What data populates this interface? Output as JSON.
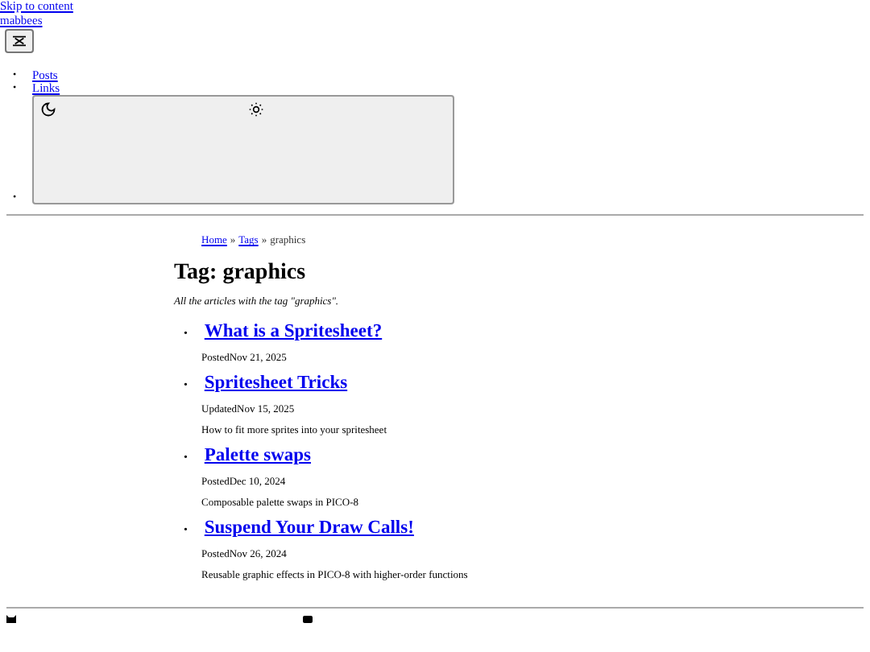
{
  "skip_link": "Skip to content",
  "site_title": "mabbees",
  "nav": {
    "items": [
      {
        "marker": "•",
        "label": "Posts"
      },
      {
        "marker": "•",
        "label": "Links"
      }
    ],
    "theme_marker": "•"
  },
  "breadcrumb": [
    {
      "label": "Home",
      "kind": "link"
    },
    {
      "label": "»",
      "kind": "sep"
    },
    {
      "label": "Tags",
      "kind": "link"
    },
    {
      "label": "»",
      "kind": "sep"
    },
    {
      "label": "graphics",
      "kind": "current"
    }
  ],
  "heading": "Tag: graphics",
  "description": "All the articles with the tag \"graphics\".",
  "posts": [
    {
      "marker": "•",
      "title": "What is a Spritesheet?",
      "date_label": "Posted",
      "date": "Nov 21, 2025"
    },
    {
      "marker": "•",
      "title": "Spritesheet Tricks",
      "date_label": "Updated",
      "date": "Nov 15, 2025",
      "summary": "How to fit more sprites into your spritesheet"
    },
    {
      "marker": "•",
      "title": "Palette swaps",
      "date_label": "Posted",
      "date": "Dec 10, 2024",
      "summary": "Composable palette swaps in PICO-8"
    },
    {
      "marker": "•",
      "title": "Suspend Your Draw Calls!",
      "date_label": "Posted",
      "date": "Nov 26, 2024",
      "summary": "Reusable graphic effects in PICO-8 with higher-order functions"
    }
  ]
}
